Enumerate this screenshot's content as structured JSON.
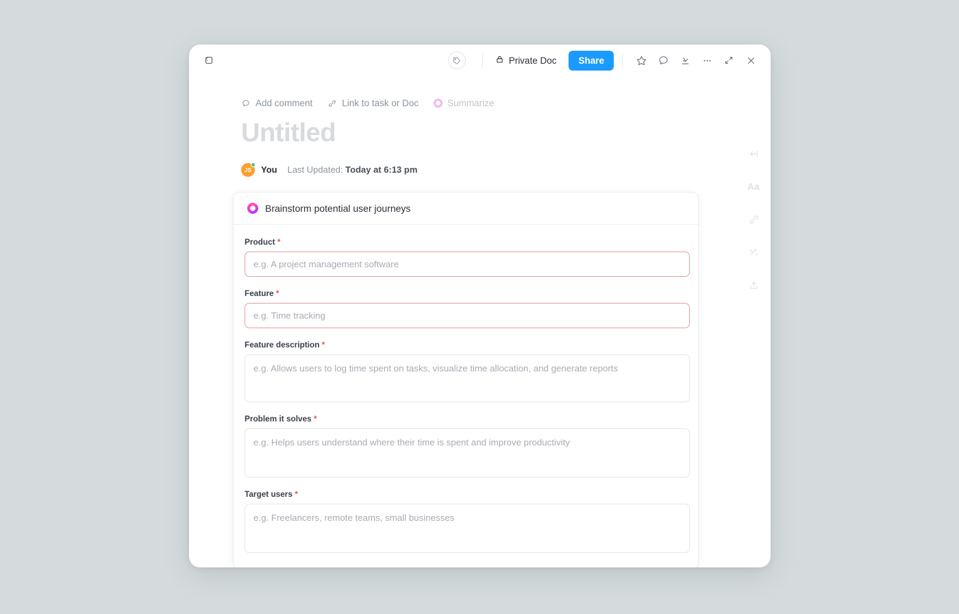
{
  "window": {
    "undo_icon": "undo-icon",
    "tag_icon": "tag-icon",
    "privacy_label": "Private Doc",
    "privacy_icon": "lock-icon",
    "share_label": "Share",
    "actions": [
      {
        "name": "favorite",
        "icon": "star-icon"
      },
      {
        "name": "comments",
        "icon": "comment-icon"
      },
      {
        "name": "download",
        "icon": "download-icon"
      },
      {
        "name": "more-options",
        "icon": "ellipsis-icon"
      },
      {
        "name": "expand",
        "icon": "expand-icon"
      },
      {
        "name": "close",
        "icon": "close-icon"
      }
    ]
  },
  "doc": {
    "quick_actions": [
      {
        "label": "Add comment",
        "icon": "comment-icon",
        "dim": false
      },
      {
        "label": "Link to task or Doc",
        "icon": "link-icon",
        "dim": false
      },
      {
        "label": "Summarize",
        "icon": "ai-sparkle-icon",
        "dim": true
      }
    ],
    "title": "Untitled",
    "author": {
      "initials": "JS",
      "name": "You",
      "presence": "online"
    },
    "last_updated_label": "Last Updated:",
    "last_updated_value": "Today at 6:13 pm"
  },
  "ai_card": {
    "icon": "ai-gradient-ring-icon",
    "title": "Brainstorm potential user journeys",
    "fields": [
      {
        "label": "Product",
        "required": true,
        "type": "input",
        "value": "",
        "placeholder": "e.g. A project management software",
        "invalid": true
      },
      {
        "label": "Feature",
        "required": true,
        "type": "input",
        "value": "",
        "placeholder": "e.g. Time tracking",
        "invalid": true
      },
      {
        "label": "Feature description",
        "required": true,
        "type": "textarea",
        "value": "",
        "placeholder": "e.g. Allows users to log time spent on tasks, visualize time allocation, and generate reports",
        "invalid": false
      },
      {
        "label": "Problem it solves",
        "required": true,
        "type": "textarea",
        "value": "",
        "placeholder": "e.g. Helps users understand where their time is spent and improve productivity",
        "invalid": false
      },
      {
        "label": "Target users",
        "required": true,
        "type": "textarea",
        "value": "",
        "placeholder": "e.g. Freelancers, remote teams, small businesses",
        "invalid": false
      }
    ]
  },
  "rail": [
    {
      "name": "collapse-sidebar",
      "icon": "arrow-left-bar-icon"
    },
    {
      "name": "text-style",
      "icon": "aa-icon",
      "glyph": "Aa"
    },
    {
      "name": "link",
      "icon": "link-icon"
    },
    {
      "name": "ai-magic",
      "icon": "magic-wand-icon"
    },
    {
      "name": "upload",
      "icon": "upload-icon"
    }
  ],
  "colors": {
    "page_background": "#d5dbdd",
    "share_button": "#1b9aff",
    "required_asterisk": "#e8544f",
    "invalid_border": "#e2a1a1",
    "avatar": "#ff9d2e",
    "presence": "#3fd07a",
    "ai_accent": "#e24fd4"
  }
}
